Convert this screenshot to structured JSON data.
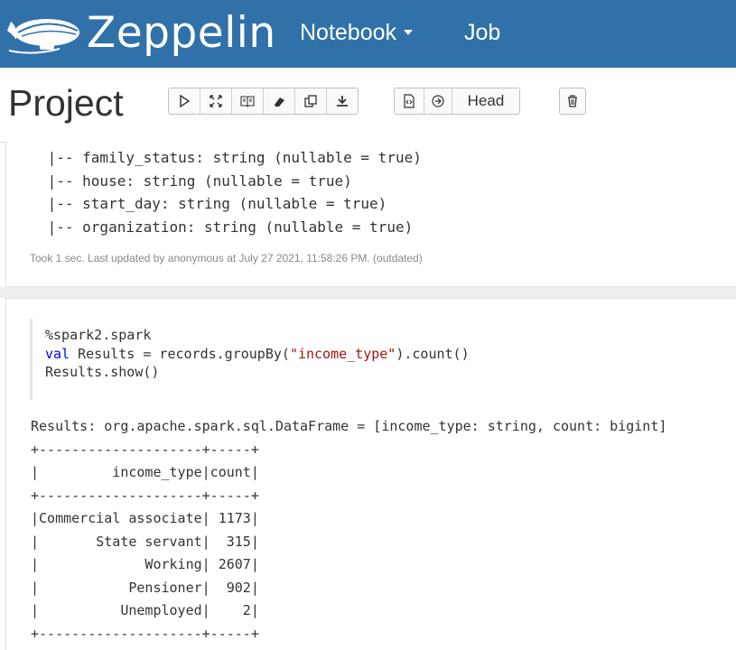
{
  "navbar": {
    "brand": "Zeppelin",
    "menu": [
      {
        "label": "Notebook",
        "has_dropdown": true
      },
      {
        "label": "Job",
        "has_dropdown": false
      }
    ],
    "logo_icon": "zeppelin-airship-icon",
    "background": "#3071a9"
  },
  "notebook": {
    "title": "Project",
    "toolbar": {
      "run_all_icon": "play-icon",
      "show_hide_code_icon": "expand-arrows-icon",
      "show_hide_output_icon": "book-icon",
      "clear_output_icon": "eraser-icon",
      "clone_icon": "copy-icon",
      "export_icon": "download-icon",
      "version_icon": "file-code-icon",
      "revision_icon": "circle-arrow-icon",
      "head_label": "Head",
      "delete_icon": "trash-icon"
    }
  },
  "paragraph1": {
    "output_lines": [
      " |-- family_status: string (nullable = true)",
      " |-- house: string (nullable = true)",
      " |-- start_day: string (nullable = true)",
      " |-- organization: string (nullable = true)"
    ],
    "status": "Took 1 sec. Last updated by anonymous at July 27 2021, 11:58:26 PM. (outdated)"
  },
  "paragraph2": {
    "code": {
      "line1": "%spark2.spark",
      "line2_keyword": "val",
      "line2_mid": " Results = records.groupBy(",
      "line2_string": "\"income_type\"",
      "line2_end": ").count()",
      "line3": "Results.show()"
    },
    "output_lines": [
      "Results: org.apache.spark.sql.DataFrame = [income_type: string, count: bigint]",
      "+--------------------+-----+",
      "|         income_type|count|",
      "+--------------------+-----+",
      "|Commercial associate| 1173|",
      "|       State servant|  315|",
      "|             Working| 2607|",
      "|           Pensioner|  902|",
      "|          Unemployed|    2|",
      "+--------------------+-----+"
    ]
  }
}
